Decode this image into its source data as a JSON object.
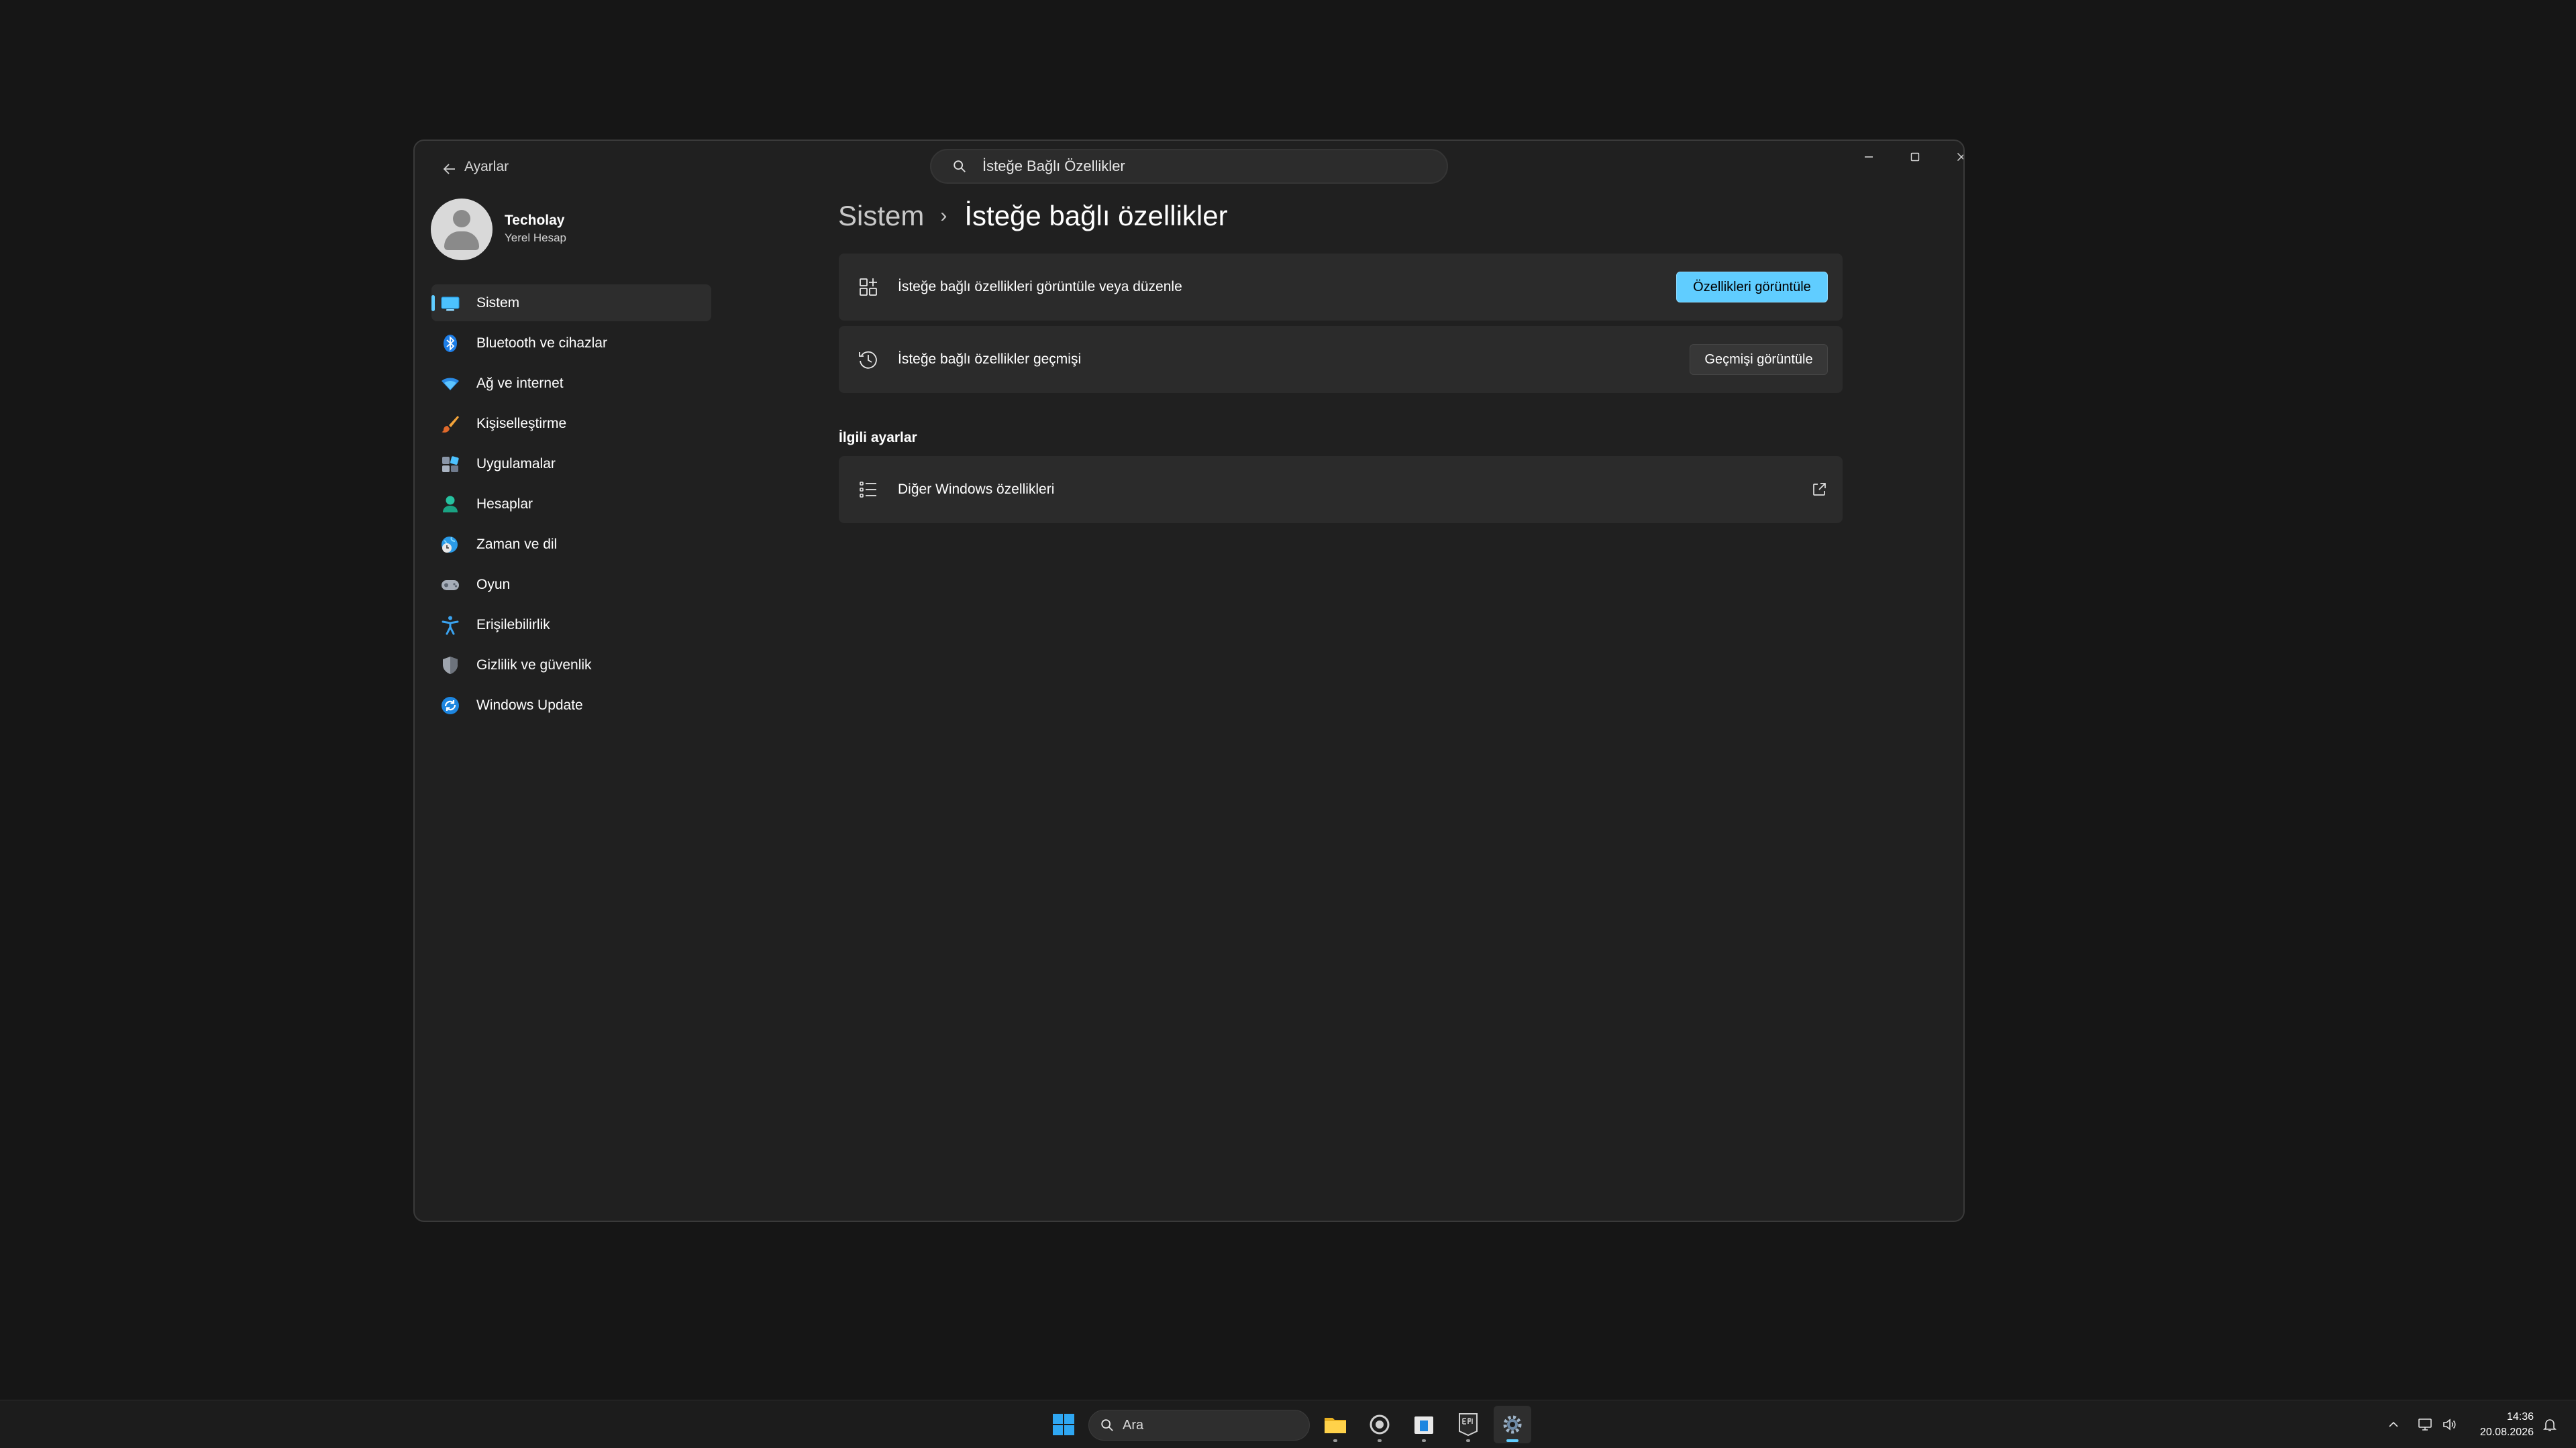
{
  "window": {
    "title": "Ayarlar",
    "search_value": "İsteğe Bağlı Özellikler"
  },
  "profile": {
    "name": "Techolay",
    "account_type": "Yerel Hesap"
  },
  "sidebar": {
    "items": [
      {
        "label": "Sistem",
        "icon": "monitor-icon",
        "active": true
      },
      {
        "label": "Bluetooth ve cihazlar",
        "icon": "bluetooth-icon"
      },
      {
        "label": "Ağ ve internet",
        "icon": "wifi-icon"
      },
      {
        "label": "Kişiselleştirme",
        "icon": "brush-icon"
      },
      {
        "label": "Uygulamalar",
        "icon": "apps-icon"
      },
      {
        "label": "Hesaplar",
        "icon": "person-icon"
      },
      {
        "label": "Zaman ve dil",
        "icon": "globe-clock-icon"
      },
      {
        "label": "Oyun",
        "icon": "gamepad-icon"
      },
      {
        "label": "Erişilebilirlik",
        "icon": "accessibility-icon"
      },
      {
        "label": "Gizlilik ve güvenlik",
        "icon": "shield-icon"
      },
      {
        "label": "Windows Update",
        "icon": "update-icon"
      }
    ]
  },
  "main": {
    "breadcrumb_parent": "Sistem",
    "breadcrumb_separator": "›",
    "breadcrumb_current": "İsteğe bağlı özellikler",
    "cards": [
      {
        "label": "İsteğe bağlı özellikleri görüntüle veya düzenle",
        "button": "Özellikleri görüntüle",
        "icon": "add-grid-icon"
      },
      {
        "label": "İsteğe bağlı özellikler geçmişi",
        "button": "Geçmişi görüntüle",
        "icon": "history-icon"
      }
    ],
    "related_title": "İlgili ayarlar",
    "related": [
      {
        "label": "Diğer Windows özellikleri",
        "icon": "list-icon"
      }
    ]
  },
  "taskbar": {
    "search_label": "Ara",
    "time": "14:36",
    "date": "20.08.2026"
  },
  "colors": {
    "accent": "#60cdff",
    "window_bg": "#202020",
    "card_bg": "#2b2b2b",
    "desktop_bg": "#161616"
  }
}
